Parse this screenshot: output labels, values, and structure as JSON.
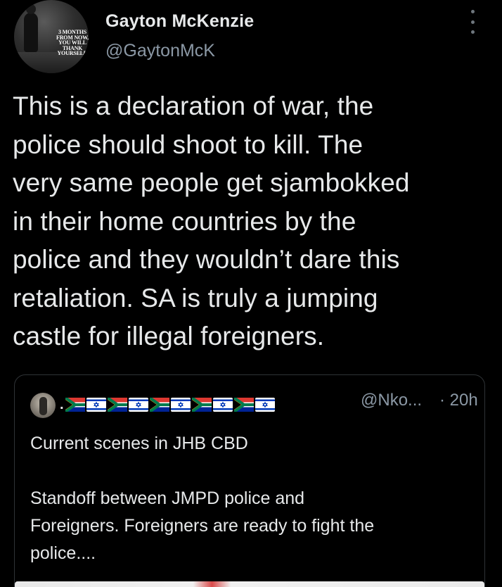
{
  "author": {
    "name": "Gayton McKenzie",
    "handle": "@GaytonMcK",
    "avatar_text": "3 MONTHS FROM NOW, YOU WILL THANK YOURSELF."
  },
  "menu": {
    "icon": "more-vertical-icon"
  },
  "tweet": {
    "lines": [
      "This is a declaration of war, the",
      "police should shoot to kill. The",
      "very same people get sjambokked",
      "in their home countries by the",
      "police and they wouldn’t dare this",
      "retaliation. SA is truly a jumping",
      "castle for illegal foreigners."
    ]
  },
  "quote": {
    "name_prefix": ".",
    "flags": [
      "south-africa-flag",
      "israel-flag",
      "south-africa-flag",
      "israel-flag",
      "south-africa-flag",
      "israel-flag",
      "south-africa-flag",
      "israel-flag",
      "south-africa-flag",
      "israel-flag"
    ],
    "handle": "@Nko...",
    "time": "· 20h",
    "paragraph1": "Current scenes in JHB CBD",
    "paragraph2_lines": [
      "Standoff between JMPD police and",
      "Foreigners. Foreigners are ready to fight the",
      "police...."
    ]
  },
  "colors": {
    "background": "#000000",
    "text": "#e7e9ea",
    "secondary": "#8b98a5",
    "border": "#2f3336"
  }
}
